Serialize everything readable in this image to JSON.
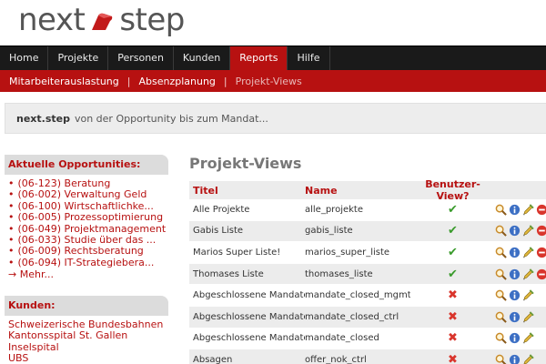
{
  "logo": {
    "left": "next",
    "right": "step"
  },
  "mainnav": [
    "Home",
    "Projekte",
    "Personen",
    "Kunden",
    "Reports",
    "Hilfe"
  ],
  "mainnav_active": "Reports",
  "subnav": [
    "Mitarbeiterauslastung",
    "Absenzplanung",
    "Projekt-Views"
  ],
  "tagline": {
    "brand": "next.step",
    "text": "von der Opportunity bis zum Mandat..."
  },
  "sidebar": {
    "opportunities": {
      "heading": "Aktuelle Opportunities:",
      "items": [
        "(06-123) Beratung",
        "(06-002) Verwaltung Geld",
        "(06-100) Wirtschaftlichke...",
        "(06-005) Prozessoptimierung",
        "(06-049) Projektmanagement",
        "(06-033) Studie über das ...",
        "(06-009) Rechtsberatung",
        "(06-094) IT-Strategiebera..."
      ],
      "more": "→ Mehr..."
    },
    "kunden": {
      "heading": "Kunden:",
      "items": [
        "Schweizerische Bundesbahnen",
        "Kantonsspital St. Gallen",
        "Inselspital",
        "UBS"
      ]
    }
  },
  "main": {
    "title": "Projekt-Views",
    "columns": {
      "title": "Titel",
      "name": "Name",
      "view": "Benutzer-View?"
    },
    "rows": [
      {
        "title": "Alle Projekte",
        "name": "alle_projekte",
        "user_view": true,
        "actions": 4
      },
      {
        "title": "Gabis Liste",
        "name": "gabis_liste",
        "user_view": true,
        "actions": 4
      },
      {
        "title": "Marios Super Liste!",
        "name": "marios_super_liste",
        "user_view": true,
        "actions": 4
      },
      {
        "title": "Thomases Liste",
        "name": "thomases_liste",
        "user_view": true,
        "actions": 4
      },
      {
        "title": "Abgeschlossene Mandate",
        "name": "mandate_closed_mgmt",
        "user_view": false,
        "actions": 3
      },
      {
        "title": "Abgeschlossene Mandate",
        "name": "mandate_closed_ctrl",
        "user_view": false,
        "actions": 3
      },
      {
        "title": "Abgeschlossene Mandate",
        "name": "mandate_closed",
        "user_view": false,
        "actions": 3
      },
      {
        "title": "Absagen",
        "name": "offer_nok_ctrl",
        "user_view": false,
        "actions": 3
      }
    ]
  },
  "icons": {
    "check": "✔",
    "cross": "✖",
    "actions": [
      "magnifier-icon",
      "info-icon",
      "edit-icon",
      "delete-icon"
    ]
  },
  "colors": {
    "brand_red": "#b71111",
    "nav_dark": "#1a1a1a",
    "check_green": "#3a9b2c",
    "cross_red": "#d9352c"
  }
}
